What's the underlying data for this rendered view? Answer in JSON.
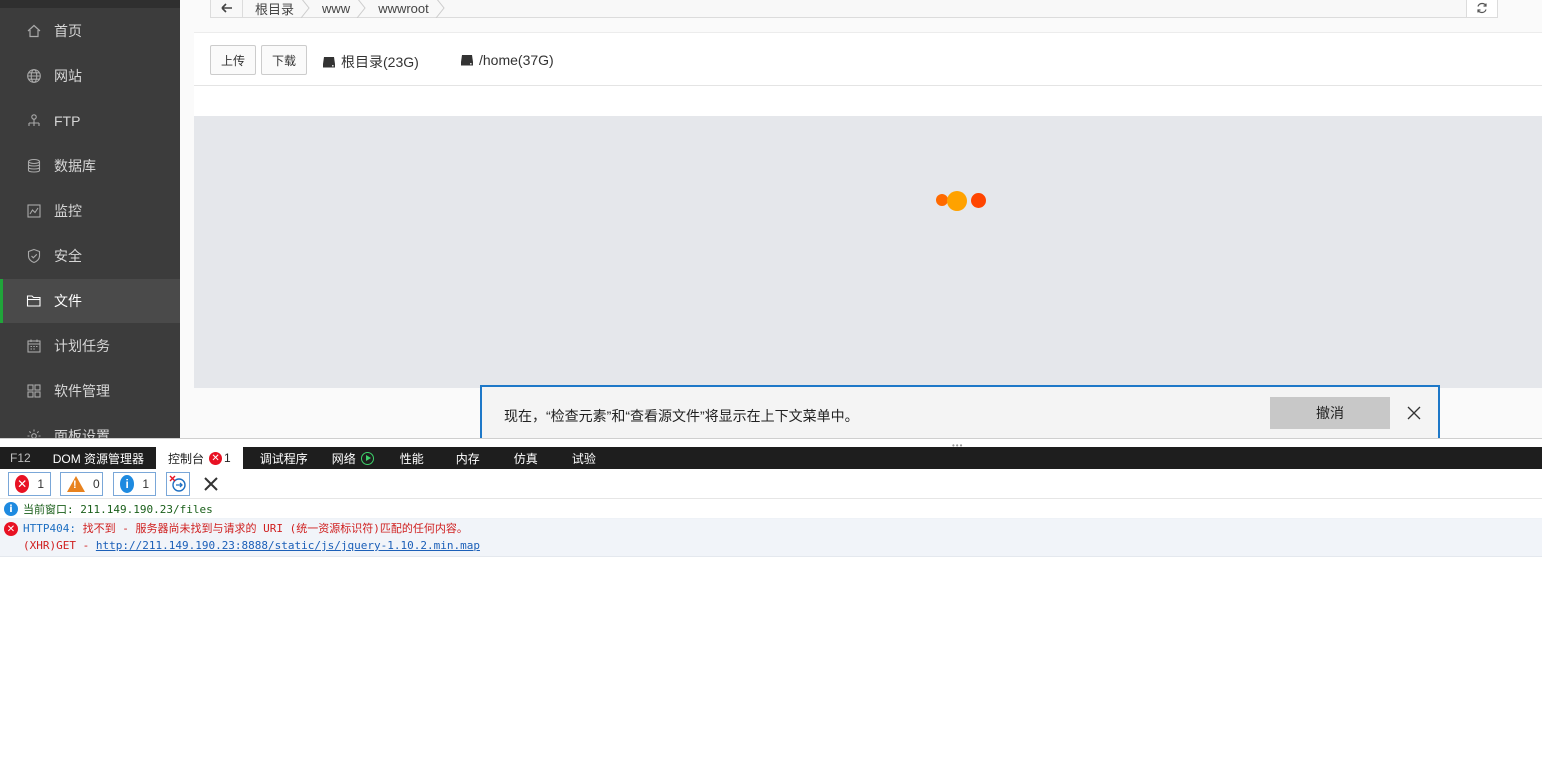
{
  "sidebar": {
    "items": [
      {
        "label": "首页",
        "icon": "home-icon"
      },
      {
        "label": "网站",
        "icon": "globe-icon"
      },
      {
        "label": "FTP",
        "icon": "ftp-icon"
      },
      {
        "label": "数据库",
        "icon": "database-icon"
      },
      {
        "label": "监控",
        "icon": "monitor-icon"
      },
      {
        "label": "安全",
        "icon": "shield-icon"
      },
      {
        "label": "文件",
        "icon": "folder-icon"
      },
      {
        "label": "计划任务",
        "icon": "calendar-icon"
      },
      {
        "label": "软件管理",
        "icon": "apps-icon"
      },
      {
        "label": "面板设置",
        "icon": "gear-icon"
      }
    ],
    "active_label": "文件",
    "accent_color": "#20a53a"
  },
  "path": {
    "crumbs": [
      "根目录",
      "www",
      "wwwroot"
    ]
  },
  "toolbar": {
    "upload_label": "上传",
    "download_label": "下载",
    "disks": [
      "根目录(23G)",
      "/home(37G)"
    ]
  },
  "loading": {
    "dot_colors": [
      "#ff6a00",
      "#ffa200",
      "#ff4500"
    ]
  },
  "notification": {
    "message": "现在，“检查元素”和“查看源文件”将显示在上下文菜单中。",
    "undo_label": "撤消",
    "border_color": "#1e78c8"
  },
  "devtools": {
    "tabs": [
      {
        "label": "F12"
      },
      {
        "label": "DOM 资源管理器"
      },
      {
        "label": "控制台",
        "error_count": "1"
      },
      {
        "label": "调试程序"
      },
      {
        "label": "网络"
      },
      {
        "label": "性能"
      },
      {
        "label": "内存"
      },
      {
        "label": "仿真"
      },
      {
        "label": "试验"
      }
    ],
    "filters": {
      "errors": "1",
      "warnings": "0",
      "info": "1"
    },
    "console": {
      "info_message": "当前窗口: 211.149.190.23/files",
      "error_code": "HTTP404:",
      "error_message": " 找不到 - 服务器尚未找到与请求的 URI (统一资源标识符)匹配的任何内容。",
      "request_prefix": "(XHR)GET - ",
      "request_url": "http://211.149.190.23:8888/static/js/jquery-1.10.2.min.map"
    }
  }
}
